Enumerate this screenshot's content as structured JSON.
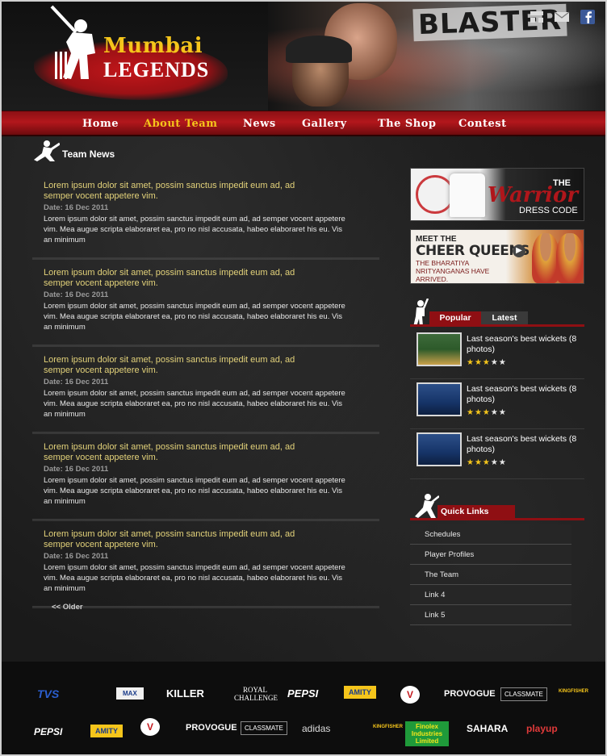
{
  "brand": {
    "logo_line1": "Mumbai",
    "logo_line2": "LEGENDS",
    "hero_text": "BLASTER"
  },
  "social": [
    {
      "icon": "sitemap-icon"
    },
    {
      "icon": "mail-icon"
    },
    {
      "icon": "facebook-icon"
    }
  ],
  "nav": [
    {
      "label": "Home",
      "active": false
    },
    {
      "label": "About Team",
      "active": true
    },
    {
      "label": "News",
      "active": false
    },
    {
      "label": "Gallery",
      "active": false
    },
    {
      "label": "The Shop",
      "active": false
    },
    {
      "label": "Contest",
      "active": false
    }
  ],
  "section": {
    "title": "Team News"
  },
  "news": [
    {
      "title": "Lorem ipsum dolor sit amet, possim sanctus impedit eum ad, ad semper vocent appetere vim.",
      "date": "Date: 16 Dec 2011",
      "body": "Lorem ipsum dolor sit amet, possim sanctus impedit eum ad, ad semper vocent appetere vim. Mea augue scripta elaboraret ea, pro no nisl accusata, habeo elaboraret his eu. Vis an minimum"
    },
    {
      "title": "Lorem ipsum dolor sit amet, possim sanctus impedit eum ad, ad semper vocent appetere vim.",
      "date": "Date: 16 Dec 2011",
      "body": "Lorem ipsum dolor sit amet, possim sanctus impedit eum ad, ad semper vocent appetere vim. Mea augue scripta elaboraret ea, pro no nisl accusata, habeo elaboraret his eu. Vis an minimum"
    },
    {
      "title": "Lorem ipsum dolor sit amet, possim sanctus impedit eum ad, ad semper vocent appetere vim.",
      "date": "Date: 16 Dec 2011",
      "body": "Lorem ipsum dolor sit amet, possim sanctus impedit eum ad, ad semper vocent appetere vim. Mea augue scripta elaboraret ea, pro no nisl accusata, habeo elaboraret his eu. Vis an minimum"
    },
    {
      "title": "Lorem ipsum dolor sit amet, possim sanctus impedit eum ad, ad semper vocent appetere vim.",
      "date": "Date: 16 Dec 2011",
      "body": "Lorem ipsum dolor sit amet, possim sanctus impedit eum ad, ad semper vocent appetere vim. Mea augue scripta elaboraret ea, pro no nisl accusata, habeo elaboraret his eu. Vis an minimum"
    },
    {
      "title": "Lorem ipsum dolor sit amet, possim sanctus impedit eum ad, ad semper vocent appetere vim.",
      "date": "Date: 16 Dec 2011",
      "body": "Lorem ipsum dolor sit amet, possim sanctus impedit eum ad, ad semper vocent appetere vim. Mea augue scripta elaboraret ea, pro no nisl accusata, habeo elaboraret his eu. Vis an minimum"
    }
  ],
  "older_label": "<< Older",
  "promos": {
    "warrior": {
      "the": "THE",
      "word": "Warrior",
      "sub": "DRESS CODE"
    },
    "cheer": {
      "meet": "MEET THE",
      "title": "CHEER QUEENS",
      "sub": "THE BHARATIYA NRITYANGANAS HAVE ARRIVED."
    }
  },
  "tabs": {
    "popular": "Popular",
    "latest": "Latest"
  },
  "media": [
    {
      "title": "Last season's best wickets (8 photos)",
      "rating": 3,
      "max": 5
    },
    {
      "title": "Last season's best wickets (8 photos)",
      "rating": 3,
      "max": 5
    },
    {
      "title": "Last season's best wickets (8 photos)",
      "rating": 3,
      "max": 5
    }
  ],
  "quick_links": {
    "title": "Quick Links",
    "items": [
      "Schedules",
      "Player Profiles",
      "The Team",
      "Link 4",
      "Link 5"
    ]
  },
  "sponsors_row1": [
    "TVS",
    "MAX",
    "KILLER",
    "ROYAL CHALLENGE",
    "PEPSI",
    "AMITY",
    "V",
    "PROVOGUE",
    "CLASSMATE",
    "KINGFISHER"
  ],
  "sponsors_row2": [
    "PEPSI",
    "AMITY",
    "V",
    "PROVOGUE",
    "CLASSMATE",
    "adidas",
    "KINGFISHER",
    "Finolex Industries Limited",
    "SAHARA",
    "playup"
  ],
  "colors": {
    "accent_red": "#b3171c",
    "gold": "#f5c51b",
    "news_title": "#e3d27a"
  }
}
